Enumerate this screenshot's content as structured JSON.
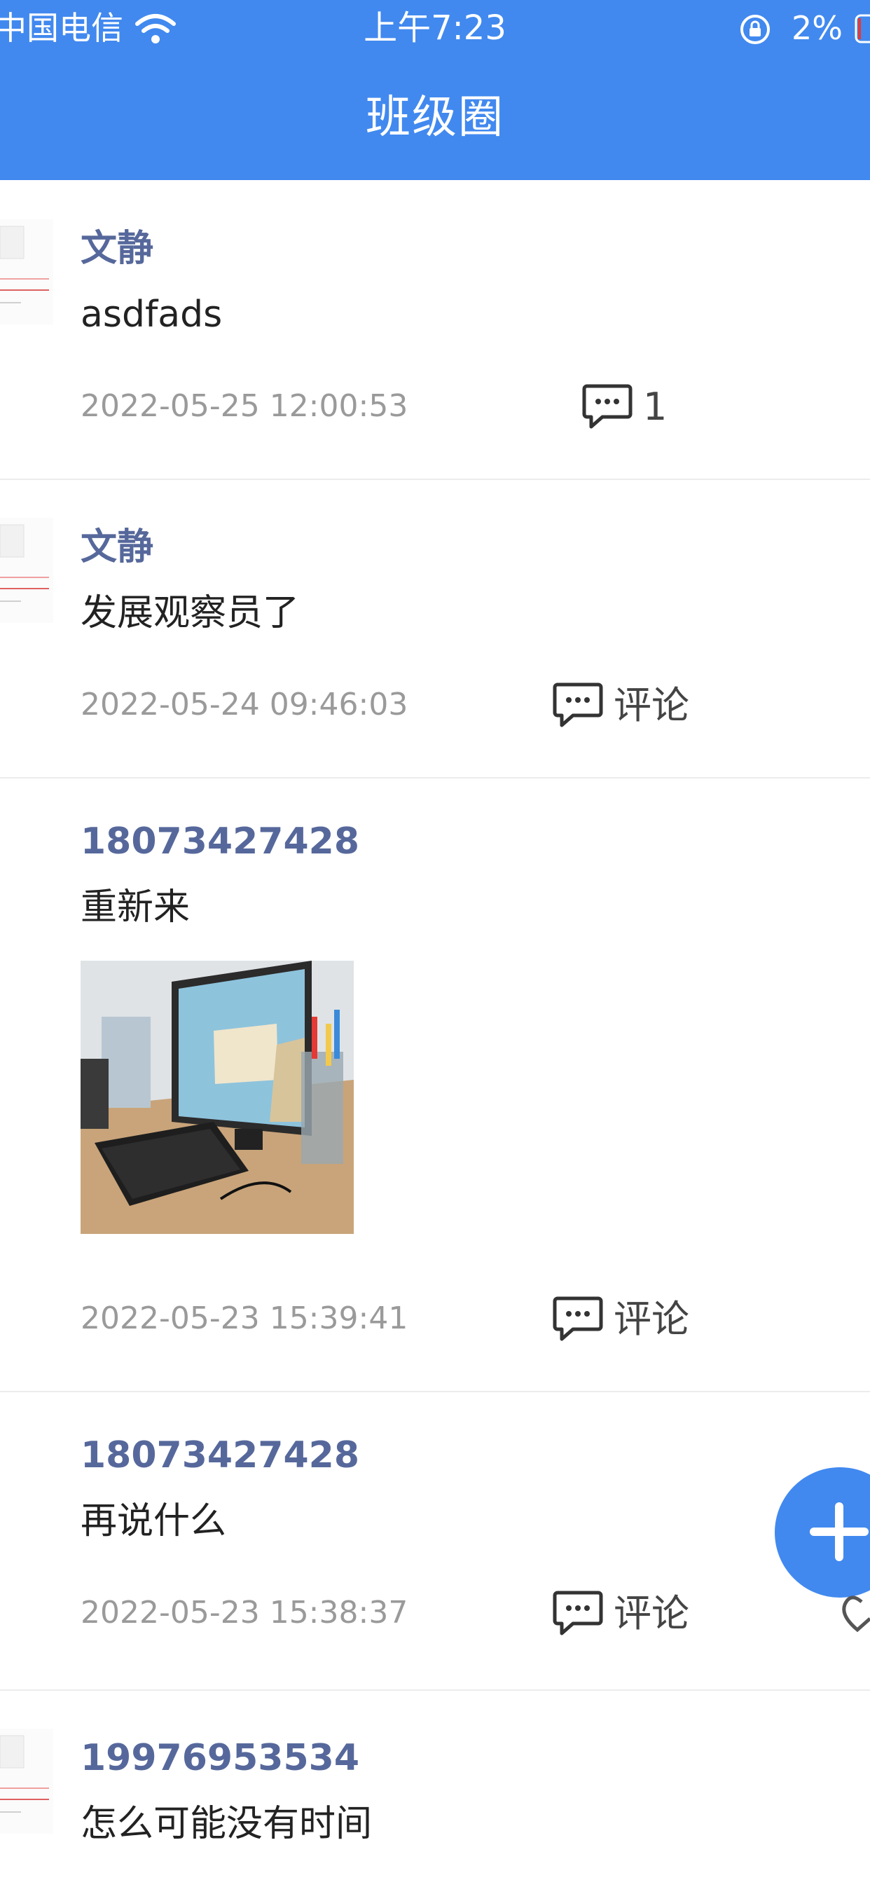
{
  "status_bar": {
    "carrier": "中国电信",
    "time": "上午7:23",
    "battery": "2%",
    "icons": [
      "wifi-icon",
      "rotation-lock-icon",
      "battery-icon"
    ]
  },
  "nav": {
    "title": "班级圈"
  },
  "posts": [
    {
      "author": "文静",
      "content": "asdfads",
      "timestamp": "2022-05-25 12:00:53",
      "comment_label": "1"
    },
    {
      "author": "文静",
      "content": "发展观察员了",
      "timestamp": "2022-05-24 09:46:03",
      "comment_label": "评论"
    },
    {
      "author": "18073427428",
      "content": "重新来",
      "timestamp": "2022-05-23 15:39:41",
      "comment_label": "评论"
    },
    {
      "author": "18073427428",
      "content": "再说什么",
      "timestamp": "2022-05-23 15:38:37",
      "comment_label": "评论"
    },
    {
      "author": "19976953534",
      "content": "怎么可能没有时间",
      "timestamp": "",
      "comment_label": ""
    }
  ],
  "fab": {
    "icon": "plus-icon"
  },
  "colors": {
    "accent": "#4189ef",
    "author": "#56689b",
    "timestamp": "#9a9a9a"
  }
}
